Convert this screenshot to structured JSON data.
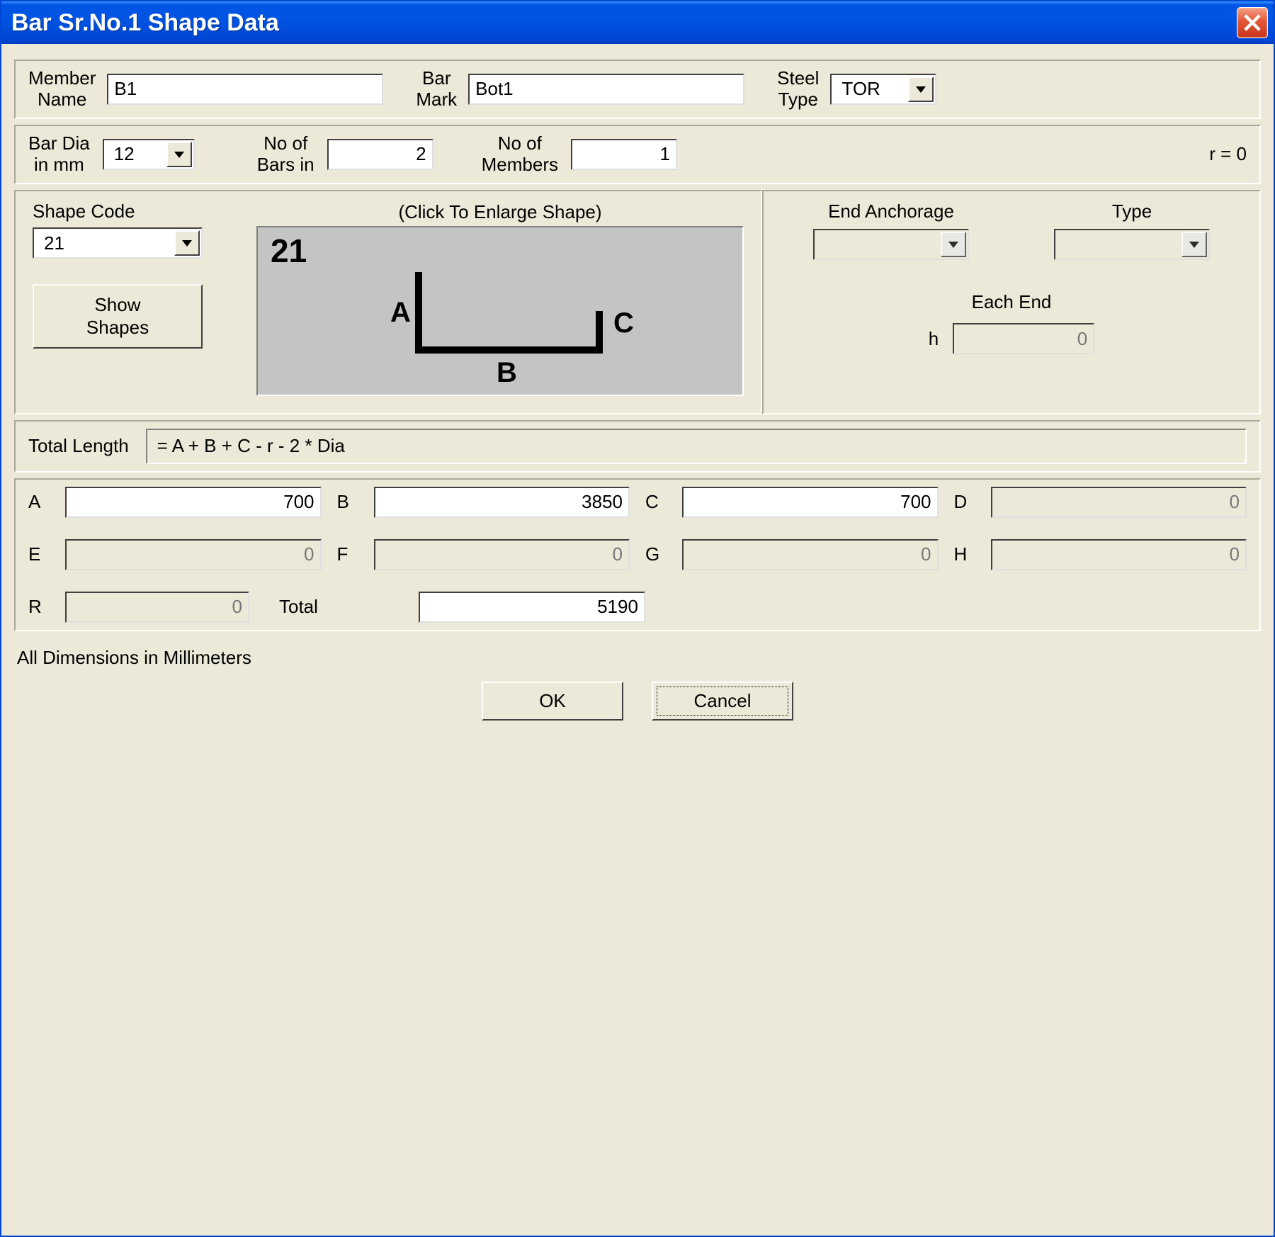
{
  "window": {
    "title": "Bar Sr.No.1 Shape Data"
  },
  "identity": {
    "member_name_label": "Member\nName",
    "member_name": "B1",
    "bar_mark_label": "Bar\nMark",
    "bar_mark": "Bot1",
    "steel_type_label": "Steel\nType",
    "steel_type": "TOR"
  },
  "bar_props": {
    "bar_dia_label": "Bar Dia\nin mm",
    "bar_dia": "12",
    "no_of_bars_label": "No of\nBars in",
    "no_of_bars": "2",
    "no_of_members_label": "No of\nMembers",
    "no_of_members": "1",
    "r_label": "r  = 0"
  },
  "shape": {
    "shape_code_label": "Shape Code",
    "shape_code": "21",
    "show_shapes_btn": "Show\nShapes",
    "preview_caption": "(Click To Enlarge Shape)",
    "preview_code": "21",
    "seg_a": "A",
    "seg_b": "B",
    "seg_c": "C"
  },
  "anchorage": {
    "end_anchorage_label": "End Anchorage",
    "type_label": "Type",
    "end_anchorage": "",
    "type": "",
    "each_end_label": "Each End",
    "h_label": "h",
    "h_value": "0"
  },
  "formula": {
    "total_length_label": "Total Length",
    "expression": "= A + B + C - r - 2 * Dia"
  },
  "dims": {
    "A": {
      "label": "A",
      "value": "700",
      "enabled": true
    },
    "B": {
      "label": "B",
      "value": "3850",
      "enabled": true
    },
    "C": {
      "label": "C",
      "value": "700",
      "enabled": true
    },
    "D": {
      "label": "D",
      "value": "0",
      "enabled": false
    },
    "E": {
      "label": "E",
      "value": "0",
      "enabled": false
    },
    "F": {
      "label": "F",
      "value": "0",
      "enabled": false
    },
    "G": {
      "label": "G",
      "value": "0",
      "enabled": false
    },
    "H": {
      "label": "H",
      "value": "0",
      "enabled": false
    },
    "R": {
      "label": "R",
      "value": "0",
      "enabled": false
    },
    "total_label": "Total",
    "total_value": "5190"
  },
  "footer": {
    "note": "All Dimensions in Millimeters",
    "ok": "OK",
    "cancel": "Cancel"
  }
}
